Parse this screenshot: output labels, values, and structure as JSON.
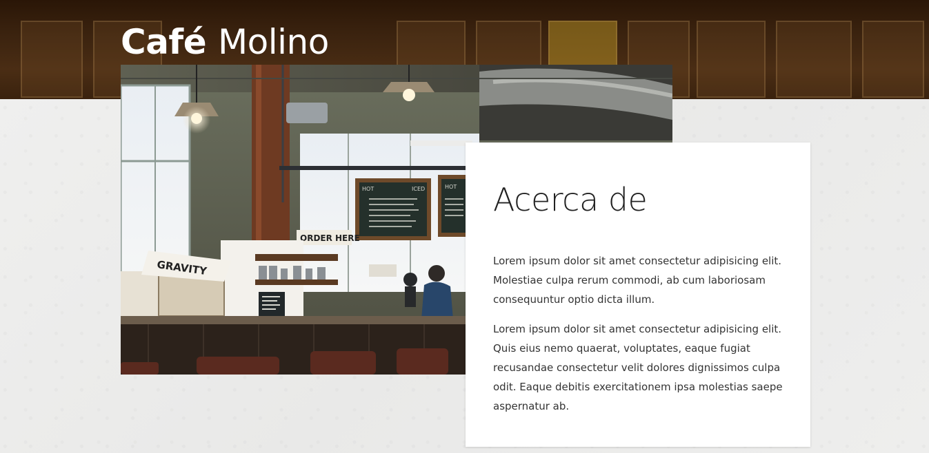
{
  "site": {
    "brand_bold": "Café",
    "brand_light": "Molino"
  },
  "about": {
    "heading": "Acerca de",
    "paragraphs": [
      "Lorem ipsum dolor sit amet consectetur adipisicing elit. Molestiae culpa rerum commodi, ab cum laboriosam consequuntur optio dicta illum.",
      "Lorem ipsum dolor sit amet consectetur adipisicing elit. Quis eius nemo quaerat, voluptates, eaque fugiat recusandae consectetur velit dolores dignissimos culpa odit. Eaque debitis exercitationem ipsa molestias saepe aspernatur ab."
    ]
  },
  "photo": {
    "signs": {
      "order_here": "ORDER HERE",
      "gravity": "GRAVITY",
      "menu_left_title": "HOT",
      "menu_left_sub": "ICED",
      "menu_right_title": "HOT"
    }
  },
  "colors": {
    "header_bg": "#3b230f",
    "page_bg": "#ececeb",
    "card_bg": "#ffffff",
    "text": "#333333"
  }
}
